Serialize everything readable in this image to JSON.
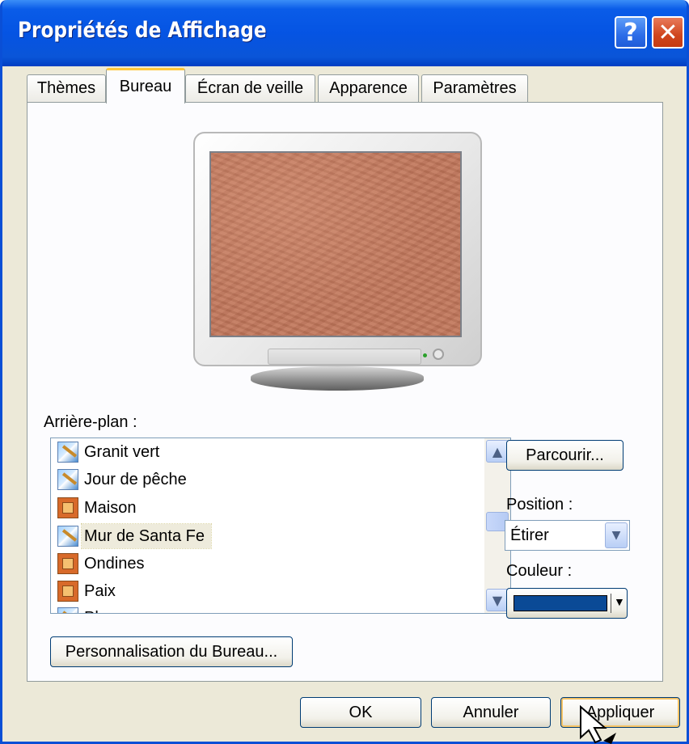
{
  "window": {
    "title": "Propriétés de Affichage",
    "help": "?",
    "close": "✕"
  },
  "tabs": [
    {
      "label": "Thèmes"
    },
    {
      "label": "Bureau"
    },
    {
      "label": "Écran de veille"
    },
    {
      "label": "Apparence"
    },
    {
      "label": "Paramètres"
    }
  ],
  "active_tab": "Bureau",
  "background": {
    "label": "Arrière-plan :",
    "items": [
      {
        "label": "Granit vert",
        "icon": "picture-icon"
      },
      {
        "label": "Jour de pêche",
        "icon": "picture-icon"
      },
      {
        "label": "Maison",
        "icon": "bitmap-icon"
      },
      {
        "label": "Mur de Santa Fe",
        "icon": "picture-icon",
        "selected": true
      },
      {
        "label": "Ondines",
        "icon": "bitmap-icon"
      },
      {
        "label": "Paix",
        "icon": "bitmap-icon"
      },
      {
        "label": "Plume",
        "icon": "picture-icon"
      }
    ],
    "browse": "Parcourir...",
    "position_label": "Position :",
    "position_value": "Étirer",
    "color_label": "Couleur :",
    "color_value": "#0a4a96"
  },
  "customize": "Personnalisation du Bureau...",
  "buttons": {
    "ok": "OK",
    "cancel": "Annuler",
    "apply": "Appliquer"
  },
  "preview_color": "#c1765a"
}
